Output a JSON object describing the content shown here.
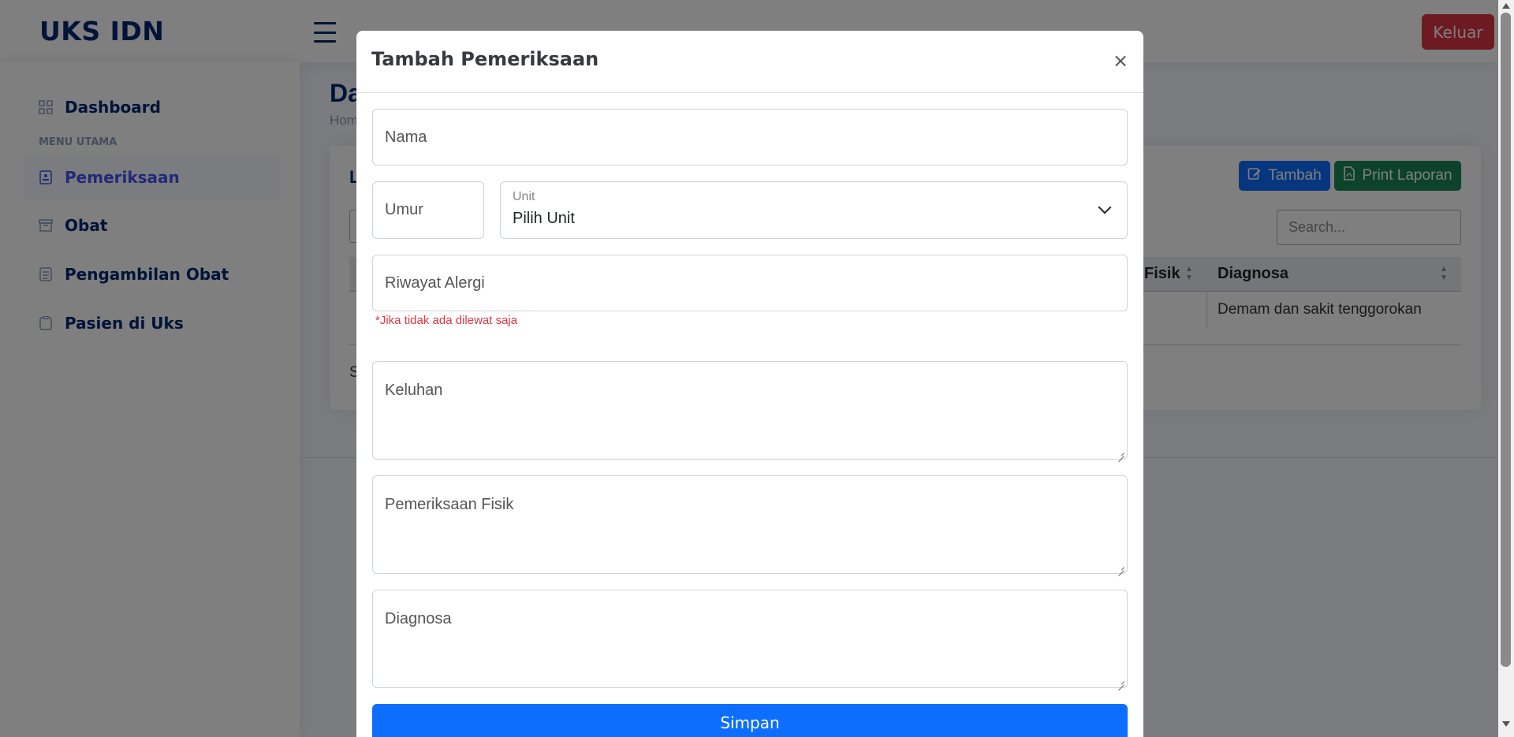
{
  "app": {
    "logo": "UKS IDN",
    "logout_label": "Keluar"
  },
  "sidebar": {
    "dashboard": "Dashboard",
    "heading": "MENU UTAMA",
    "items": [
      "Pemeriksaan",
      "Obat",
      "Pengambilan Obat",
      "Pasien di Uks"
    ]
  },
  "page": {
    "title_partial": "Da",
    "breadcrumb_partial": "Hom",
    "card_title_partial": "L",
    "tambah_label": "Tambah",
    "print_label": "Print Laporan",
    "search_placeholder": "Search...",
    "col_fisik_partial": "Fisik",
    "col_diagnosa": "Diagnosa",
    "row_diagnosa": "Demam dan sakit tenggorokan",
    "info_partial": "S"
  },
  "modal": {
    "title": "Tambah Pemeriksaan",
    "close": "×",
    "nama_placeholder": "Nama",
    "umur_placeholder": "Umur",
    "unit_label": "Unit",
    "unit_value": "Pilih Unit",
    "alergi_placeholder": "Riwayat Alergi",
    "alergi_hint": "*Jika tidak ada dilewat saja",
    "keluhan_placeholder": "Keluhan",
    "fisik_placeholder": "Pemeriksaan Fisik",
    "diagnosa_placeholder": "Diagnosa",
    "submit_label": "Simpan"
  },
  "colors": {
    "primary": "#0d6efd",
    "success": "#198754",
    "danger": "#dc3545",
    "navy": "#012970"
  }
}
